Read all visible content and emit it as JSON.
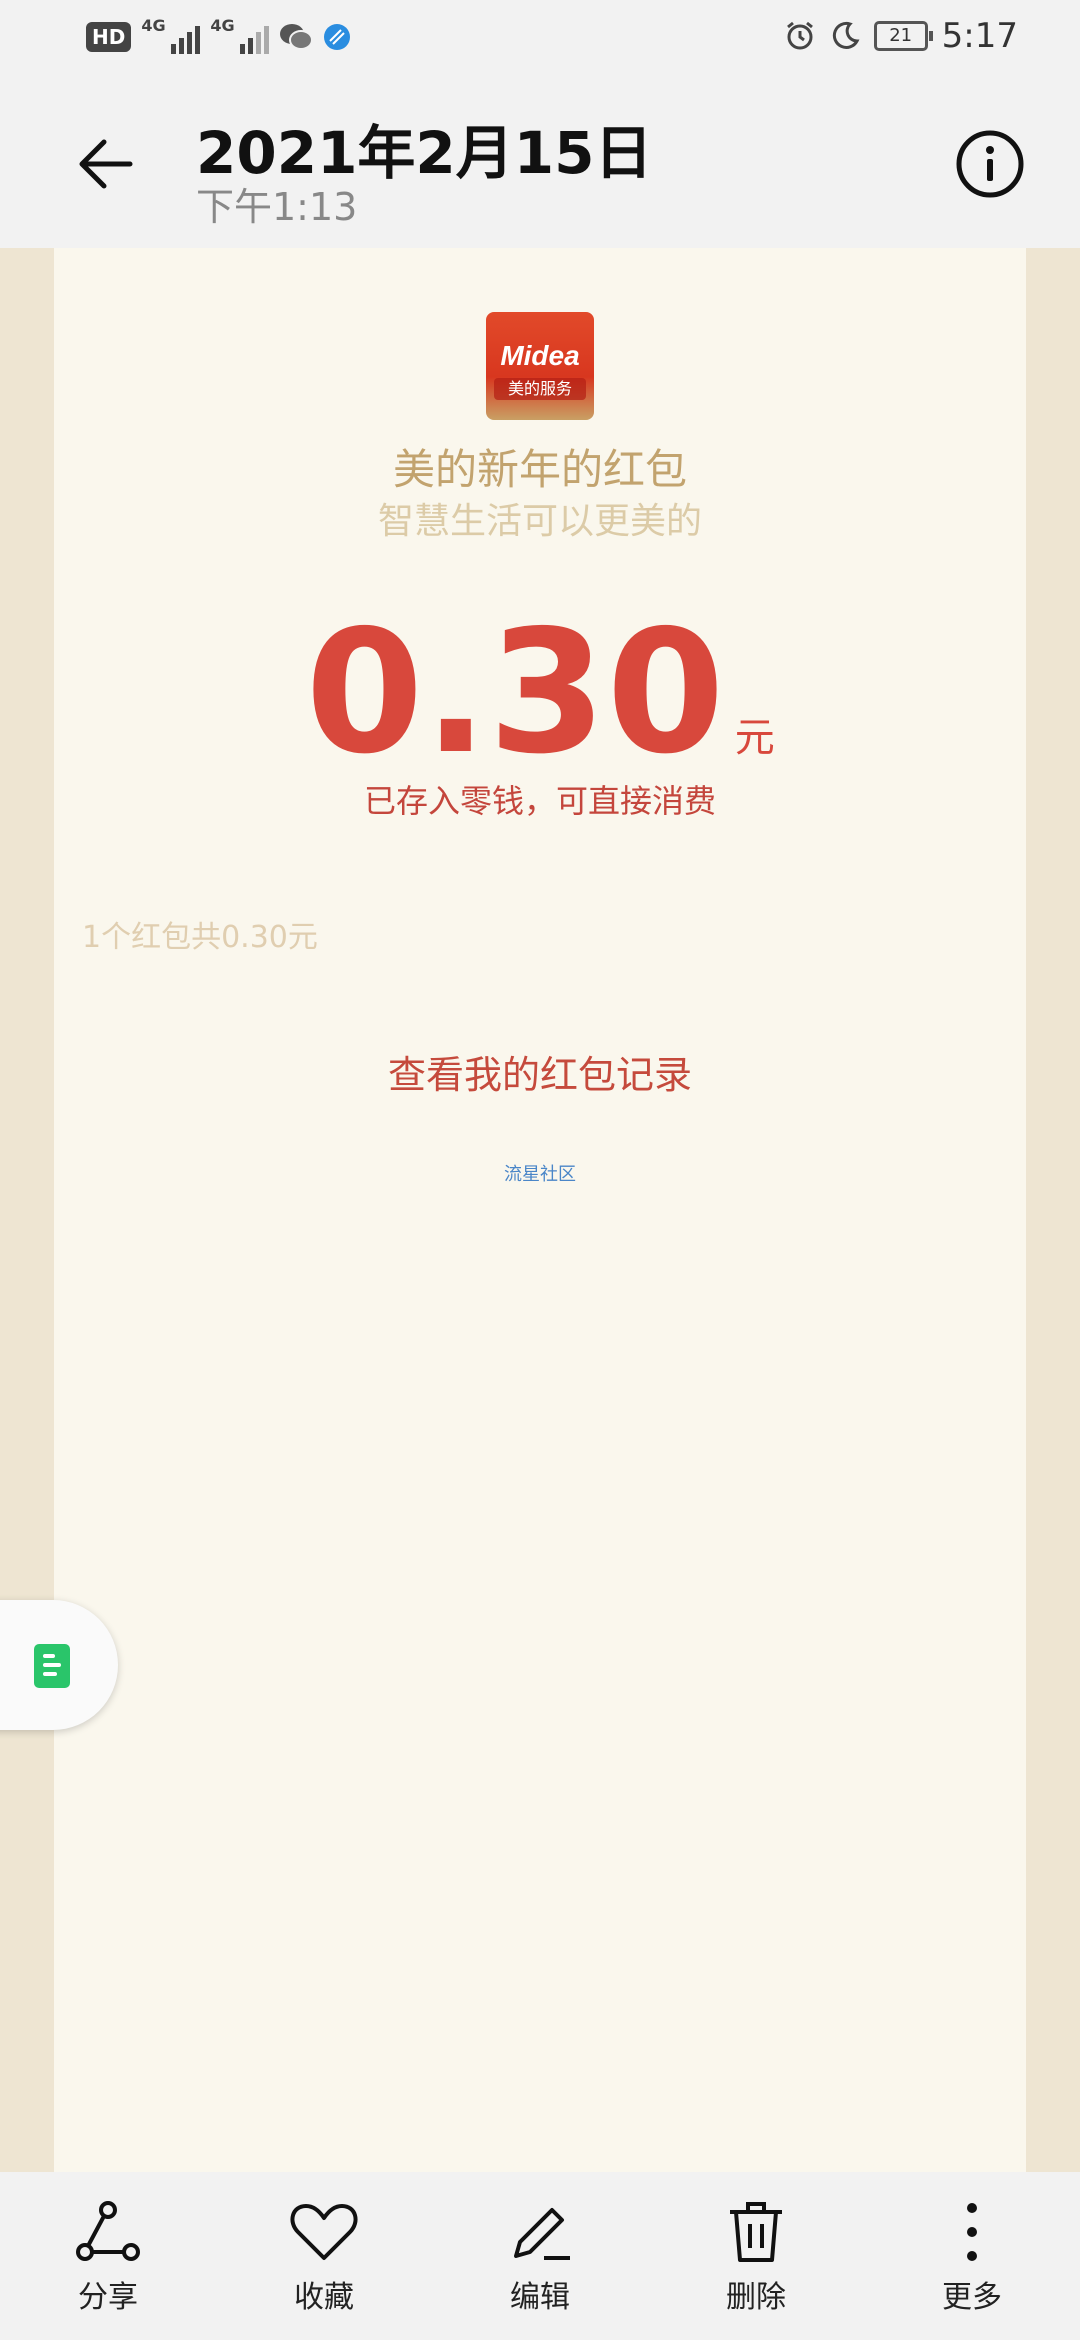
{
  "status_bar": {
    "hd": "HD",
    "network1": "4G",
    "network2": "4G",
    "battery": "21",
    "time": "5:17"
  },
  "header": {
    "date": "2021年2月15日",
    "time": "下午1:13"
  },
  "red_packet": {
    "logo_brand": "Midea",
    "logo_sub": "美的服务",
    "title": "美的新年的红包",
    "subtitle": "智慧生活可以更美的",
    "amount": "0.30",
    "unit": "元",
    "note": "已存入零钱，可直接消费",
    "count_text": "1个红包共0.30元",
    "records_link": "查看我的红包记录",
    "community": "流星社区"
  },
  "toolbar": {
    "share": "分享",
    "favorite": "收藏",
    "edit": "编辑",
    "delete": "删除",
    "more": "更多"
  },
  "colors": {
    "amount": "#d8483c",
    "title_gold": "#c2a36e",
    "card_bg": "#faf7ed"
  },
  "icons": [
    "back-arrow-icon",
    "info-icon",
    "share-icon",
    "heart-icon",
    "pencil-icon",
    "trash-icon",
    "more-dots-icon",
    "note-icon",
    "alarm-icon",
    "moon-icon",
    "wechat-icon"
  ]
}
